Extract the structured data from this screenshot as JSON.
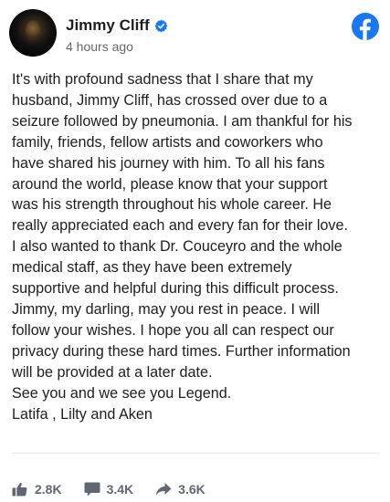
{
  "post": {
    "author": "Jimmy Cliff",
    "timestamp": "4 hours ago",
    "body_lines": [
      "It's with profound sadness that I share that my",
      "husband, Jimmy Cliff, has crossed over due to a",
      "seizure followed by pneumonia. I am thankful for his",
      "family, friends, fellow artists and coworkers who",
      "have shared his journey with him. To all his fans",
      "around the world, please know that your support",
      "was his strength throughout his whole career. He",
      "really appreciated each and every fan for their love.",
      "I also wanted to thank Dr. Couceyro and the whole",
      "medical staff, as they have been extremely",
      "supportive and helpful during this difficult process.",
      "Jimmy, my darling, may you rest in peace. I will",
      "follow your wishes. I hope you all can respect our",
      "privacy during these hard times. Further information",
      "will be provided at a later date.",
      "See you and we see you Legend.",
      "Latifa , Lilty and Aken"
    ]
  },
  "stats": {
    "likes": "2.8K",
    "comments": "3.4K",
    "shares": "3.6K"
  },
  "icons": {
    "verified": "verified-badge-icon",
    "platform": "facebook-logo-icon",
    "like": "thumbs-up-icon",
    "comment": "comment-bubble-icon",
    "share": "share-arrow-icon"
  },
  "colors": {
    "facebook_blue": "#1877f2",
    "text": "#1c1e21",
    "secondary_text": "#65676b",
    "stat_gray": "#606770"
  }
}
